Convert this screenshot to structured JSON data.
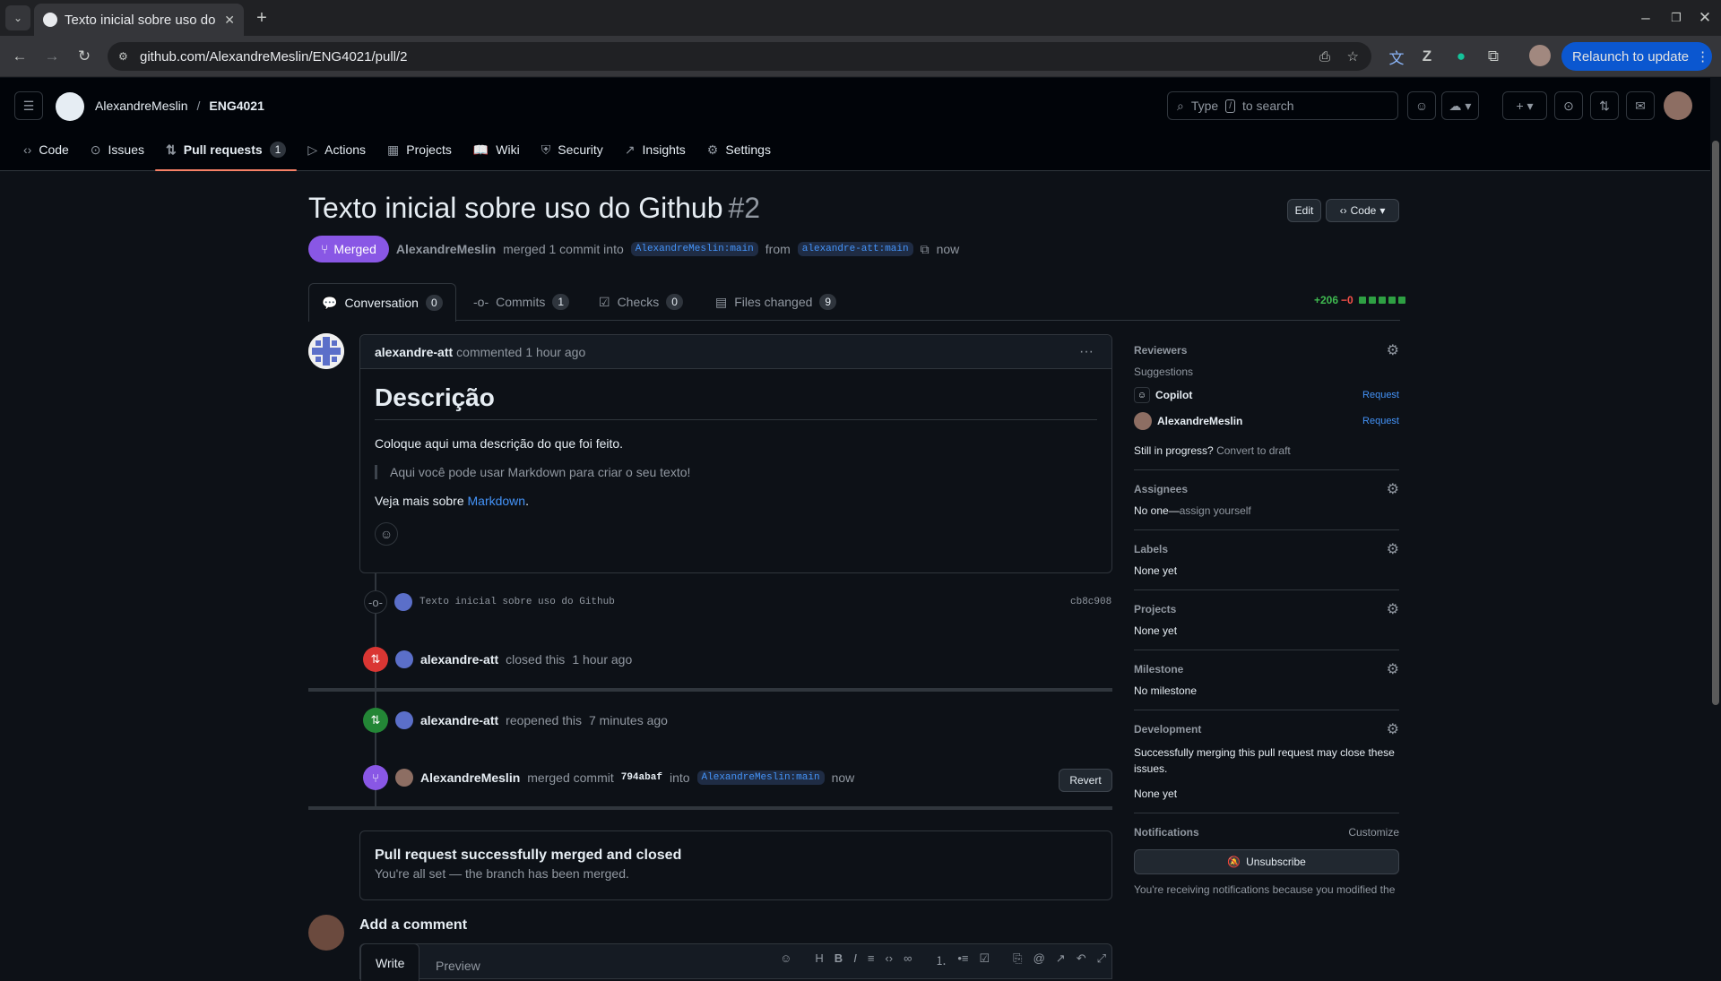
{
  "browser": {
    "tab_title": "Texto inicial sobre uso do Github",
    "url": "github.com/AlexandreMeslin/ENG4021/pull/2",
    "relaunch": "Relaunch to update"
  },
  "header": {
    "owner": "AlexandreMeslin",
    "repo": "ENG4021",
    "search_pre": "Type",
    "search_key": "/",
    "search_post": "to search"
  },
  "repo_tabs": [
    {
      "label": "Code",
      "icon": "code-icon"
    },
    {
      "label": "Issues",
      "icon": "issue-icon"
    },
    {
      "label": "Pull requests",
      "icon": "pull-request-icon",
      "count": "1"
    },
    {
      "label": "Actions",
      "icon": "play-icon"
    },
    {
      "label": "Projects",
      "icon": "table-icon"
    },
    {
      "label": "Wiki",
      "icon": "book-icon"
    },
    {
      "label": "Security",
      "icon": "shield-icon"
    },
    {
      "label": "Insights",
      "icon": "graph-icon"
    },
    {
      "label": "Settings",
      "icon": "gear-icon"
    }
  ],
  "pr": {
    "title": "Texto inicial sobre uso do Github",
    "number": "#2",
    "edit": "Edit",
    "code": "Code",
    "state": "Merged",
    "author": "AlexandreMeslin",
    "action": "merged 1 commit into",
    "base": "AlexandreMeslin:main",
    "from": "from",
    "head": "alexandre-att:main",
    "time": "now"
  },
  "pr_tabs": [
    {
      "label": "Conversation",
      "count": "0"
    },
    {
      "label": "Commits",
      "count": "1"
    },
    {
      "label": "Checks",
      "count": "0"
    },
    {
      "label": "Files changed",
      "count": "9"
    }
  ],
  "diffstat": {
    "add": "+206",
    "del": "−0"
  },
  "comment": {
    "author": "alexandre-att",
    "verb": "commented",
    "time": "1 hour ago",
    "heading": "Descrição",
    "p1": "Coloque aqui uma descrição do que foi feito.",
    "quote": "Aqui você pode usar Markdown para criar o seu texto!",
    "p3_pre": "Veja mais sobre",
    "p3_link": "Markdown",
    "p3_post": "."
  },
  "timeline": {
    "commit_msg": "Texto inicial sobre uso do Github",
    "commit_sha": "cb8c908",
    "closed_user": "alexandre-att",
    "closed_verb": "closed this",
    "closed_time": "1 hour ago",
    "reopened_user": "alexandre-att",
    "reopened_verb": "reopened this",
    "reopened_time": "7 minutes ago",
    "merged_user": "AlexandreMeslin",
    "merged_verb": "merged commit",
    "merged_sha": "794abaf",
    "merged_into": "into",
    "merged_branch": "AlexandreMeslin:main",
    "merged_time": "now",
    "revert": "Revert"
  },
  "merge_box": {
    "title": "Pull request successfully merged and closed",
    "subtitle": "You're all set — the branch has been merged."
  },
  "add_comment": {
    "title": "Add a comment",
    "write": "Write",
    "preview": "Preview"
  },
  "sidebar": {
    "reviewers": "Reviewers",
    "suggestions": "Suggestions",
    "rev1": "Copilot",
    "rev2": "AlexandreMeslin",
    "request": "Request",
    "in_progress": "Still in progress?",
    "convert": "Convert to draft",
    "assignees": "Assignees",
    "assignees_val": "No one—",
    "assign_self": "assign yourself",
    "labels": "Labels",
    "labels_val": "None yet",
    "projects": "Projects",
    "projects_val": "None yet",
    "milestone": "Milestone",
    "milestone_val": "No milestone",
    "development": "Development",
    "dev_desc": "Successfully merging this pull request may close these issues.",
    "dev_val": "None yet",
    "notifications": "Notifications",
    "customize": "Customize",
    "unsubscribe": "Unsubscribe",
    "notif_note": "You're receiving notifications because you modified the"
  },
  "colors": {
    "merged": "#8957e5",
    "closed": "#da3633",
    "reopened": "#238636",
    "link": "#4493f8"
  }
}
